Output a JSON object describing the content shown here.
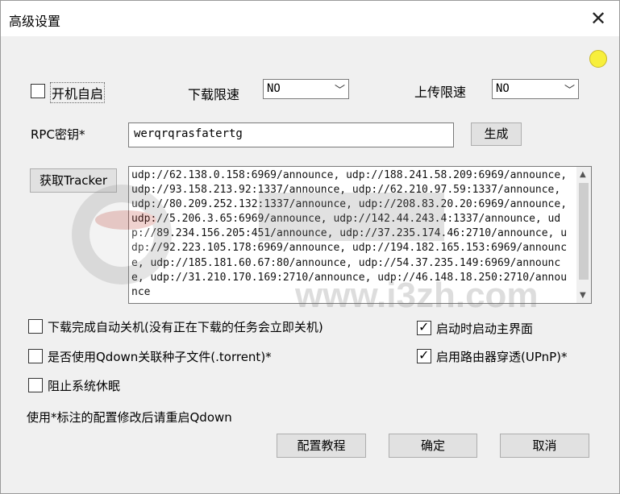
{
  "window": {
    "title": "高级设置",
    "close_glyph": "✕"
  },
  "startup": {
    "label": "开机自启",
    "checked": false
  },
  "download_limit": {
    "label": "下载限速",
    "value": "NO"
  },
  "upload_limit": {
    "label": "上传限速",
    "value": "NO"
  },
  "rpc": {
    "label": "RPC密钥*",
    "value": "werqrqrasfatertg",
    "generate_button": "生成"
  },
  "tracker": {
    "button": "获取Tracker",
    "text": "udp://62.138.0.158:6969/announce, udp://188.241.58.209:6969/announce, udp://93.158.213.92:1337/announce, udp://62.210.97.59:1337/announce, udp://80.209.252.132:1337/announce, udp://208.83.20.20:6969/announce, udp://5.206.3.65:6969/announce, udp://142.44.243.4:1337/announce, udp://89.234.156.205:451/announce, udp://37.235.174.46:2710/announce, udp://92.223.105.178:6969/announce, udp://194.182.165.153:6969/announce, udp://185.181.60.67:80/announce, udp://54.37.235.149:6969/announce, udp://31.210.170.169:2710/announce, udp://46.148.18.250:2710/announce"
  },
  "options": {
    "auto_shutdown": {
      "label": "下载完成自动关机(没有正在下载的任务会立即关机)",
      "checked": false
    },
    "show_main": {
      "label": "启动时启动主界面",
      "checked": true
    },
    "associate_torrent": {
      "label": "是否使用Qdown关联种子文件(.torrent)*",
      "checked": false
    },
    "upnp": {
      "label": "启用路由器穿透(UPnP)*",
      "checked": true
    },
    "prevent_sleep": {
      "label": "阻止系统休眠",
      "checked": false
    }
  },
  "note": "使用*标注的配置修改后请重启Qdown",
  "buttons": {
    "tutorial": "配置教程",
    "ok": "确定",
    "cancel": "取消"
  },
  "watermark": {
    "text": "www.i3zh.com"
  },
  "colors": {
    "status_dot": "#f7ef3c",
    "dialog_bg": "#f0f0f0",
    "button_bg": "#e1e1e1"
  }
}
